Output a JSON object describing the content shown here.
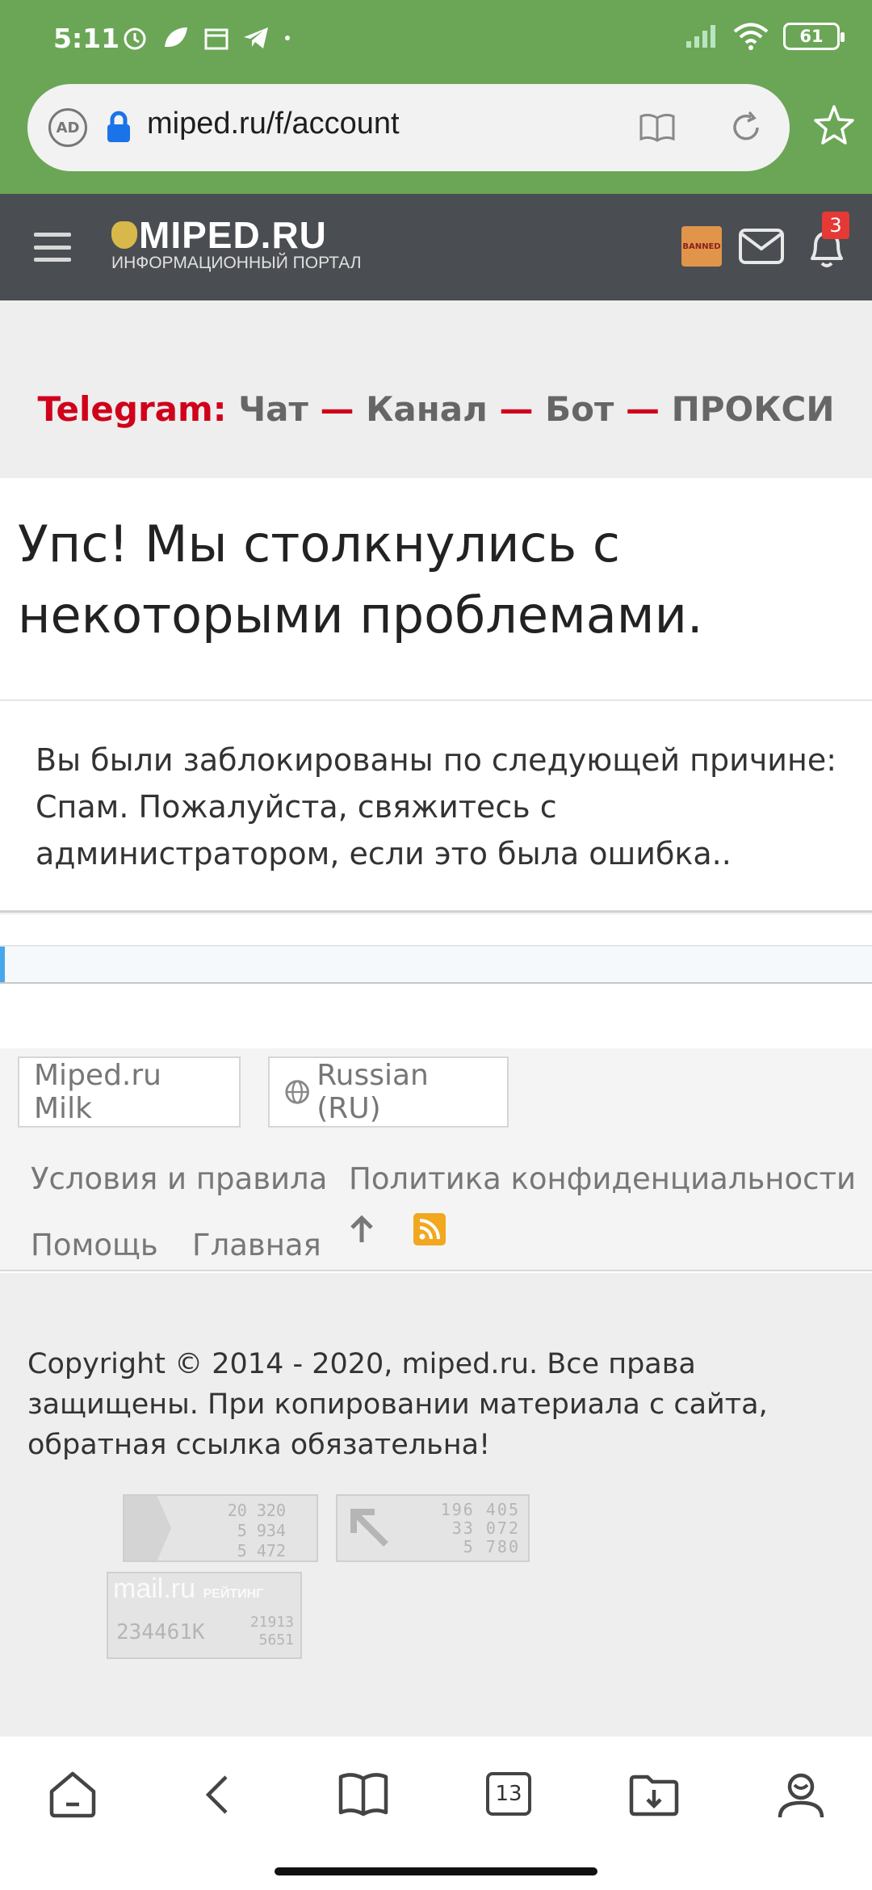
{
  "status_bar": {
    "time": "5:11",
    "battery": "61"
  },
  "browser": {
    "url": "miped.ru/f/account",
    "adblock_label": "AD",
    "tabs_count": "13"
  },
  "site": {
    "logo_main": "MIPED.RU",
    "logo_sub": "ИНФОРМАЦИОННЫЙ ПОРТАЛ",
    "avatar_label": "BANNED",
    "notification_count": "3"
  },
  "telegram": {
    "label": "Telegram:",
    "links": [
      "Чат",
      "Канал",
      "Бот",
      "ПРОКСИ"
    ],
    "separator": "—"
  },
  "error": {
    "title": "Упс! Мы столкнулись с некоторыми проблемами.",
    "message": "Вы были заблокированы по следующей причине: Спам. Пожалуйста, свяжитесь с администратором, если это была ошибка.."
  },
  "footer": {
    "style_chooser": "Miped.ru Milk",
    "language_chooser": "Russian (RU)",
    "links": {
      "terms": "Условия и правила",
      "privacy": "Политика конфиденциальности",
      "help": "Помощь",
      "home": "Главная"
    },
    "copyright": "Copyright © 2014 - 2020, miped.ru. Все права защищены. При копировании материала с сайта, обратная ссылка обязательна!"
  },
  "counters": {
    "liveinternet": [
      "20 320",
      "5 934",
      "5 472"
    ],
    "counter2": [
      "196 405",
      "33 072",
      "5 780"
    ],
    "mailru": {
      "brand": "mail.ru",
      "label": "РЕЙТИНГ",
      "total": "234461K",
      "values": [
        "21913",
        "5651"
      ]
    }
  },
  "colors": {
    "chrome_green": "#6aa656",
    "header_dark": "#4a4d52",
    "telegram_red": "#d0021b",
    "badge_red": "#e53935",
    "rss_orange": "#f1a81f"
  }
}
